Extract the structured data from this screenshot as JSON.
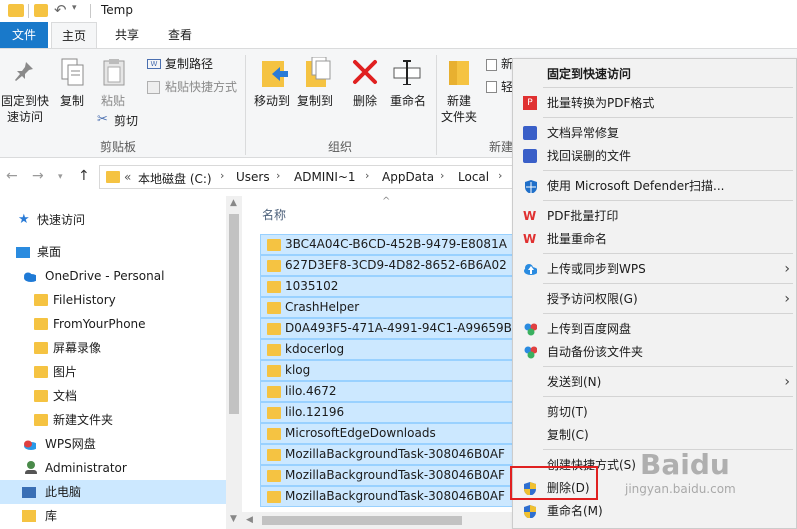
{
  "window": {
    "title": "Temp"
  },
  "tabs": [
    "文件",
    "主页",
    "共享",
    "查看"
  ],
  "ribbon": {
    "pin": [
      "固定到快",
      "速访问"
    ],
    "copy": "复制",
    "paste": "粘贴",
    "copy_path": "复制路径",
    "paste_shortcut": "粘贴快捷方式",
    "cut": "剪切",
    "move_to": "移动到",
    "copy_to": "复制到",
    "delete": "删除",
    "rename": "重命名",
    "new_folder": [
      "新建",
      "文件夹"
    ],
    "new_item_partial": "新",
    "easy_access_partial": "轻",
    "group_clipboard": "剪贴板",
    "group_organize": "组织",
    "group_new_partial": "新建"
  },
  "address": {
    "prefix": "«",
    "crumbs": [
      "本地磁盘 (C:)",
      "Users",
      "ADMINI~1",
      "AppData",
      "Local"
    ]
  },
  "navpane": {
    "items": [
      {
        "label": "快速访问",
        "icon": "star-icon"
      },
      {
        "label": "桌面",
        "icon": "desktop-icon"
      },
      {
        "label": "OneDrive - Personal",
        "icon": "cloud-icon"
      },
      {
        "label": "FileHistory",
        "icon": "folder-icon"
      },
      {
        "label": "FromYourPhone",
        "icon": "folder-icon"
      },
      {
        "label": "屏幕录像",
        "icon": "folder-icon"
      },
      {
        "label": "图片",
        "icon": "folder-icon"
      },
      {
        "label": "文档",
        "icon": "folder-icon"
      },
      {
        "label": "新建文件夹",
        "icon": "folder-icon"
      },
      {
        "label": "WPS网盘",
        "icon": "cloud-icon"
      },
      {
        "label": "Administrator",
        "icon": "user-icon"
      },
      {
        "label": "此电脑",
        "icon": "computer-icon"
      },
      {
        "label": "库",
        "icon": "library-icon"
      }
    ]
  },
  "filelist": {
    "column_name": "名称",
    "files": [
      "3BC4A04C-B6CD-452B-9479-E8081A",
      "627D3EF8-3CD9-4D82-8652-6B6A02",
      "1035102",
      "CrashHelper",
      "D0A493F5-471A-4991-94C1-A99659B",
      "kdocerlog",
      "klog",
      "lilo.4672",
      "lilo.12196",
      "MicrosoftEdgeDownloads",
      "MozillaBackgroundTask-308046B0AF",
      "MozillaBackgroundTask-308046B0AF",
      "MozillaBackgroundTask-308046B0AF"
    ]
  },
  "context_menu": {
    "items": [
      {
        "label": "固定到快速访问",
        "bold": true,
        "icon": ""
      },
      {
        "label": "批量转换为PDF格式",
        "icon": "pdf-icon"
      },
      {
        "label": "文档异常修复",
        "icon": "repair-icon"
      },
      {
        "label": "找回误删的文件",
        "icon": "recover-icon"
      },
      {
        "label": "使用 Microsoft Defender扫描...",
        "icon": "defender-icon"
      },
      {
        "label": "PDF批量打印",
        "icon": "wps-icon"
      },
      {
        "label": "批量重命名",
        "icon": "wps-icon"
      },
      {
        "label": "上传或同步到WPS",
        "icon": "upload-cloud-icon",
        "arrow": true
      },
      {
        "label": "授予访问权限(G)",
        "icon": "",
        "arrow": true
      },
      {
        "label": "上传到百度网盘",
        "icon": "baidu-icon"
      },
      {
        "label": "自动备份该文件夹",
        "icon": "baidu-icon"
      },
      {
        "label": "发送到(N)",
        "icon": "",
        "arrow": true
      },
      {
        "label": "剪切(T)",
        "icon": ""
      },
      {
        "label": "复制(C)",
        "icon": ""
      },
      {
        "label": "创建快捷方式(S)",
        "icon": ""
      },
      {
        "label": "删除(D)",
        "icon": "shield-icon"
      },
      {
        "label": "重命名(M)",
        "icon": "shield-icon"
      }
    ]
  },
  "watermark": {
    "brand": "Baidu",
    "sub": "jingyan.baidu.com"
  },
  "colors": {
    "accent": "#1979ca",
    "selection": "#cce8ff",
    "highlight_box": "#e02020",
    "folder": "#f5c342"
  }
}
